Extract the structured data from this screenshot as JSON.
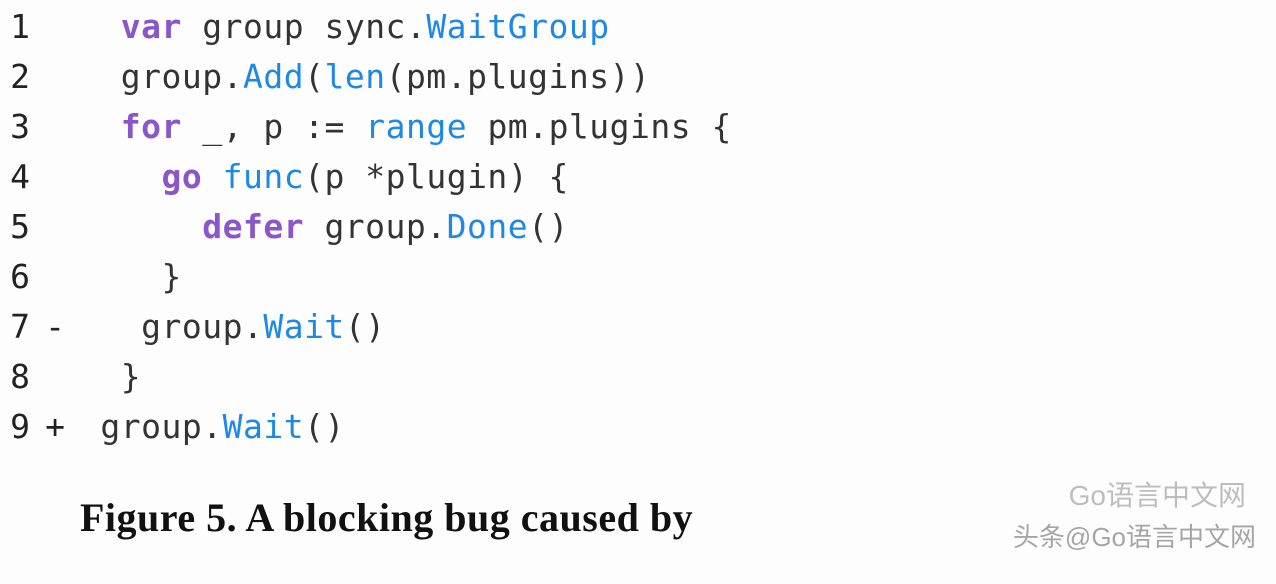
{
  "code": {
    "lines": [
      {
        "n": "1",
        "diff": "",
        "indent": "  ",
        "tokens": [
          {
            "t": "var",
            "c": "kw"
          },
          {
            "t": " ",
            "c": "pun"
          },
          {
            "t": "group",
            "c": "id"
          },
          {
            "t": " ",
            "c": "pun"
          },
          {
            "t": "sync",
            "c": "id"
          },
          {
            "t": ".",
            "c": "pun"
          },
          {
            "t": "WaitGroup",
            "c": "fn"
          }
        ]
      },
      {
        "n": "2",
        "diff": "",
        "indent": "  ",
        "tokens": [
          {
            "t": "group",
            "c": "id"
          },
          {
            "t": ".",
            "c": "pun"
          },
          {
            "t": "Add",
            "c": "fn"
          },
          {
            "t": "(",
            "c": "pun"
          },
          {
            "t": "len",
            "c": "fn"
          },
          {
            "t": "(",
            "c": "pun"
          },
          {
            "t": "pm",
            "c": "id"
          },
          {
            "t": ".",
            "c": "pun"
          },
          {
            "t": "plugins",
            "c": "id"
          },
          {
            "t": "))",
            "c": "pun"
          }
        ]
      },
      {
        "n": "3",
        "diff": "",
        "indent": "  ",
        "tokens": [
          {
            "t": "for",
            "c": "kw"
          },
          {
            "t": " ",
            "c": "pun"
          },
          {
            "t": "_",
            "c": "id"
          },
          {
            "t": ", ",
            "c": "pun"
          },
          {
            "t": "p",
            "c": "id"
          },
          {
            "t": " := ",
            "c": "pun"
          },
          {
            "t": "range",
            "c": "fn"
          },
          {
            "t": " ",
            "c": "pun"
          },
          {
            "t": "pm",
            "c": "id"
          },
          {
            "t": ".",
            "c": "pun"
          },
          {
            "t": "plugins",
            "c": "id"
          },
          {
            "t": " {",
            "c": "pun"
          }
        ]
      },
      {
        "n": "4",
        "diff": "",
        "indent": "    ",
        "tokens": [
          {
            "t": "go",
            "c": "kw"
          },
          {
            "t": " ",
            "c": "pun"
          },
          {
            "t": "func",
            "c": "fn"
          },
          {
            "t": "(",
            "c": "pun"
          },
          {
            "t": "p",
            "c": "id"
          },
          {
            "t": " *",
            "c": "pun"
          },
          {
            "t": "plugin",
            "c": "id"
          },
          {
            "t": ") {",
            "c": "pun"
          }
        ]
      },
      {
        "n": "5",
        "diff": "",
        "indent": "      ",
        "tokens": [
          {
            "t": "defer",
            "c": "kw"
          },
          {
            "t": " ",
            "c": "pun"
          },
          {
            "t": "group",
            "c": "id"
          },
          {
            "t": ".",
            "c": "pun"
          },
          {
            "t": "Done",
            "c": "fn"
          },
          {
            "t": "()",
            "c": "pun"
          }
        ]
      },
      {
        "n": "6",
        "diff": "",
        "indent": "    ",
        "tokens": [
          {
            "t": "}",
            "c": "pun"
          }
        ]
      },
      {
        "n": "7",
        "diff": "-",
        "indent": "   ",
        "tokens": [
          {
            "t": "group",
            "c": "id"
          },
          {
            "t": ".",
            "c": "pun"
          },
          {
            "t": "Wait",
            "c": "fn"
          },
          {
            "t": "()",
            "c": "pun"
          }
        ]
      },
      {
        "n": "8",
        "diff": "",
        "indent": "  ",
        "tokens": [
          {
            "t": "}",
            "c": "pun"
          }
        ]
      },
      {
        "n": "9",
        "diff": "+",
        "indent": " ",
        "tokens": [
          {
            "t": "group",
            "c": "id"
          },
          {
            "t": ".",
            "c": "pun"
          },
          {
            "t": "Wait",
            "c": "fn"
          },
          {
            "t": "()",
            "c": "pun"
          }
        ]
      }
    ]
  },
  "caption": "Figure 5. A blocking bug caused by",
  "watermark1": "Go语言中文网",
  "watermark2": "头条@Go语言中文网"
}
